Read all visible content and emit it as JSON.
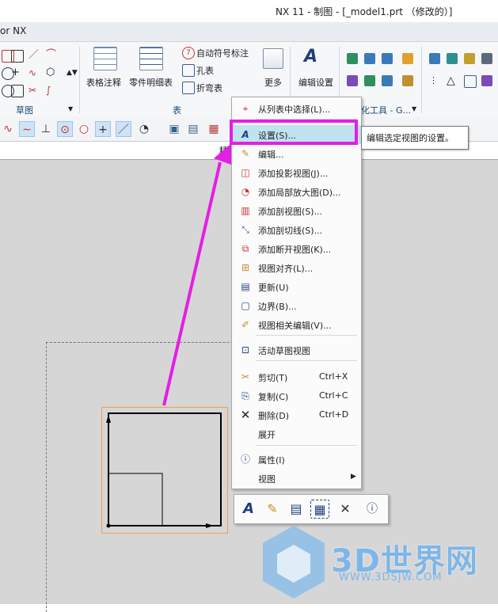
{
  "window": {
    "title": "NX 11 - 制图 - [_model1.prt （修改的）]"
  },
  "app_bar": {
    "name": "or NX"
  },
  "ribbon": {
    "sketch_group_label": "草图",
    "table_group_label": "表",
    "buttons": {
      "table_note": "表格注释",
      "parts_list": "零件明细表",
      "auto_balloon": "自动符号标注",
      "hole_table": "孔表",
      "bend_table": "折弯表",
      "more": "更多",
      "edit_settings": "编辑设置"
    },
    "partial_label": "化工具 - G...",
    "partial_tab": "精"
  },
  "context_menu": {
    "items": [
      {
        "label": "从列表中选择(L)...",
        "icon": "crosshair-icon"
      },
      {
        "label": "设置(S)...",
        "icon": "settings-A-icon",
        "highlighted": true
      },
      {
        "label": "编辑...",
        "icon": "edit-icon"
      },
      {
        "label": "添加投影视图(J)...",
        "icon": "projected-view-icon"
      },
      {
        "label": "添加局部放大图(D)...",
        "icon": "detail-view-icon"
      },
      {
        "label": "添加剖视图(S)...",
        "icon": "section-view-icon"
      },
      {
        "label": "添加剖切线(S)...",
        "icon": "section-line-icon"
      },
      {
        "label": "添加断开视图(K)...",
        "icon": "break-view-icon"
      },
      {
        "label": "视图对齐(L)...",
        "icon": "align-view-icon"
      },
      {
        "label": "更新(U)",
        "icon": "update-icon"
      },
      {
        "label": "边界(B)...",
        "icon": "boundary-icon"
      },
      {
        "label": "视图相关编辑(V)...",
        "icon": "view-dependent-edit-icon"
      },
      {
        "label": "活动草图视图",
        "icon": "active-sketch-view-icon"
      },
      {
        "label": "剪切(T)",
        "shortcut": "Ctrl+X",
        "icon": "scissors-icon"
      },
      {
        "label": "复制(C)",
        "shortcut": "Ctrl+C",
        "icon": "copy-icon"
      },
      {
        "label": "删除(D)",
        "shortcut": "Ctrl+D",
        "icon": "delete-x-icon"
      },
      {
        "label": "展开",
        "icon": ""
      },
      {
        "label": "属性(I)",
        "icon": "properties-icon"
      },
      {
        "label": "视图",
        "icon": "",
        "submenu": true
      }
    ]
  },
  "tooltip": {
    "text": "编辑选定视图的设置。"
  },
  "watermark": {
    "text": "3D世界网",
    "url": "WWW.3DSJW.COM"
  },
  "colors": {
    "highlight": "#e51ee5",
    "menu_selected": "#bfe3ef",
    "view_border": "#f0a050"
  }
}
